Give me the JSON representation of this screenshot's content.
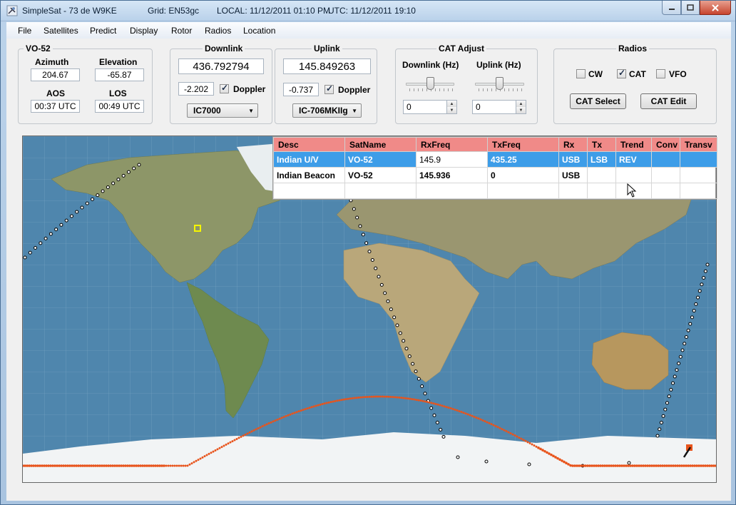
{
  "window": {
    "app_title": "SimpleSat - 73 de W9KE",
    "grid": "Grid: EN53gc",
    "local": "LOCAL: 11/12/2011 01:10 PM",
    "utc": "UTC: 11/12/2011 19:10"
  },
  "menu": [
    "File",
    "Satellites",
    "Predict",
    "Display",
    "Rotor",
    "Radios",
    "Location"
  ],
  "satellite": {
    "name": "VO-52",
    "azimuth_label": "Azimuth",
    "azimuth": "204.67",
    "elevation_label": "Elevation",
    "elevation": "-65.87",
    "aos_label": "AOS",
    "aos": "00:37 UTC",
    "los_label": "LOS",
    "los": "00:49 UTC"
  },
  "downlink": {
    "title": "Downlink",
    "freq": "436.792794",
    "doppler": "-2.202",
    "doppler_label": "Doppler",
    "doppler_checked": true,
    "radio": "IC7000"
  },
  "uplink": {
    "title": "Uplink",
    "freq": "145.849263",
    "doppler": "-0.737",
    "doppler_label": "Doppler",
    "doppler_checked": true,
    "radio": "IC-706MKIIg"
  },
  "cat_adjust": {
    "title": "CAT Adjust",
    "downlink_label": "Downlink (Hz)",
    "uplink_label": "Uplink (Hz)",
    "downlink_value": "0",
    "uplink_value": "0",
    "downlink_slider": 0.5,
    "uplink_slider": 0.5
  },
  "radios": {
    "title": "Radios",
    "cw_label": "CW",
    "cw_checked": false,
    "cat_label": "CAT",
    "cat_checked": true,
    "vfo_label": "VFO",
    "vfo_checked": false,
    "cat_select": "CAT Select",
    "cat_edit": "CAT Edit"
  },
  "grid": {
    "columns": [
      "Desc",
      "SatName",
      "RxFreq",
      "TxFreq",
      "Rx",
      "Tx",
      "Trend",
      "Conv",
      "Transv"
    ],
    "rows": [
      [
        "Indian U/V",
        "VO-52",
        "145.9",
        "435.25",
        "USB",
        "LSB",
        "REV",
        "",
        ""
      ],
      [
        "Indian Beacon",
        "VO-52",
        "145.936",
        "0",
        "USB",
        "",
        "",
        "",
        ""
      ],
      [
        "",
        "",
        "",
        "",
        "",
        "",
        "",
        "",
        ""
      ]
    ]
  },
  "colors": {
    "header_bg": "#f08a88",
    "selected_row": "#3d9de8",
    "ground_track": "#e8541c",
    "observer_marker": "#f5f500"
  },
  "icons": [
    "satellite-app-icon",
    "minimize-icon",
    "maximize-icon",
    "close-icon",
    "dropdown-arrow-icon",
    "spin-up-icon",
    "spin-down-icon",
    "mouse-cursor-icon"
  ]
}
